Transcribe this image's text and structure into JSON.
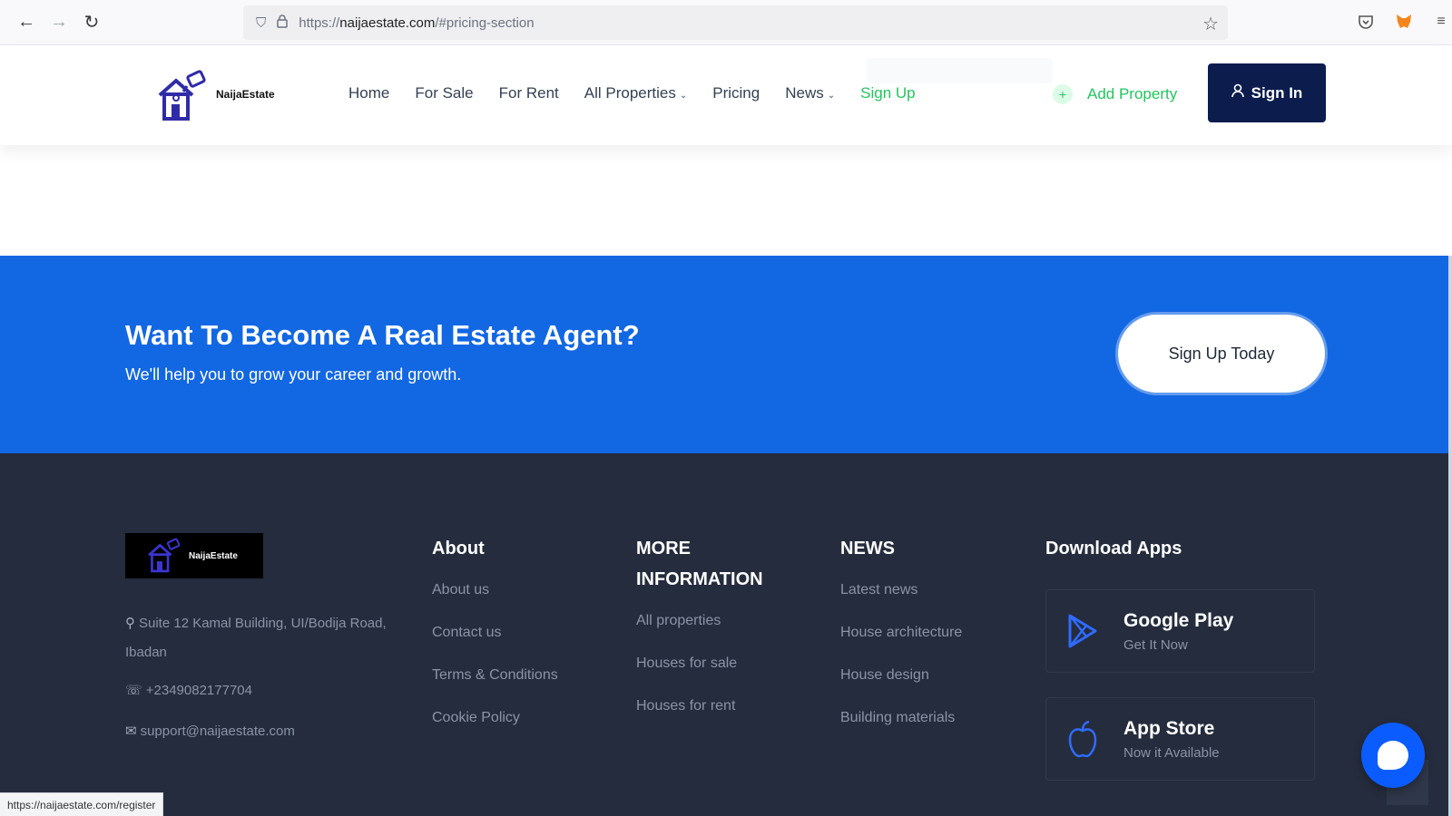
{
  "browser": {
    "url_prefix": "https://",
    "url_host": "naijaestate.com",
    "url_path": "/#pricing-section",
    "back_icon": "←",
    "forward_icon": "→",
    "reload_icon": "↻",
    "status_url": "https://naijaestate.com/register"
  },
  "header": {
    "logo_text": "NaijaEstate",
    "nav": [
      {
        "label": "Home"
      },
      {
        "label": "For Sale"
      },
      {
        "label": "For Rent"
      },
      {
        "label": "All Properties",
        "caret": "⌄"
      },
      {
        "label": "Pricing"
      },
      {
        "label": "News",
        "caret": "⌄"
      },
      {
        "label": "Sign Up"
      }
    ],
    "add_property": "Add Property",
    "sign_in": "Sign In"
  },
  "cta": {
    "title": "Want To Become A Real Estate Agent?",
    "subtitle": "We'll help you to grow your career and growth.",
    "button": "Sign Up Today"
  },
  "footer": {
    "logo_text": "NaijaEstate",
    "address": "Suite 12 Kamal Building, UI/Bodija Road, Ibadan",
    "phone": "+2349082177704",
    "email": "support@naijaestate.com",
    "about": {
      "heading": "About",
      "links": [
        "About us",
        "Contact us",
        "Terms & Conditions",
        "Cookie Policy"
      ]
    },
    "more_info": {
      "heading": "MORE INFORMATION",
      "links": [
        "All properties",
        "Houses for sale",
        "Houses for rent"
      ]
    },
    "news": {
      "heading": "NEWS",
      "links": [
        "Latest news",
        "House architecture",
        "House design",
        "Building materials"
      ]
    },
    "apps": {
      "heading": "Download Apps",
      "google_play": {
        "title": "Google Play",
        "sub": "Get It Now"
      },
      "app_store": {
        "title": "App Store",
        "sub": "Now it Available"
      }
    }
  },
  "colors": {
    "brand_blue": "#1267e3",
    "navy": "#0b1c4d",
    "green": "#22c55e",
    "footer_bg": "#252c3d"
  }
}
